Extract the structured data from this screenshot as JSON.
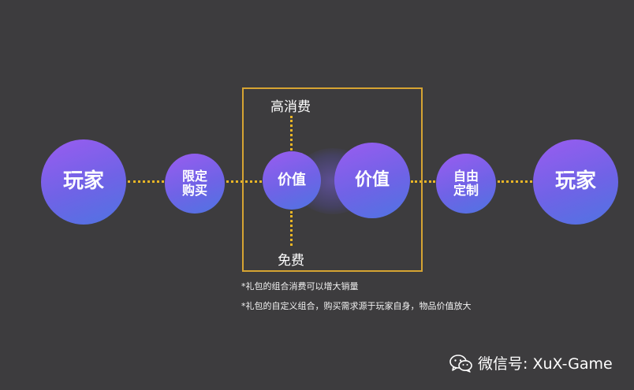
{
  "nodes": {
    "player_left": "玩家",
    "limited_line1": "限定",
    "limited_line2": "购买",
    "value_small": "价值",
    "value_large": "价值",
    "custom_line1": "自由",
    "custom_line2": "定制",
    "player_right": "玩家"
  },
  "axis": {
    "top_label": "高消费",
    "bottom_label": "免费"
  },
  "notes": [
    "*礼包的组合消费可以增大销量",
    "*礼包的自定义组合，购买需求源于玩家自身，物品价值放大"
  ],
  "watermark": {
    "icon": "wechat-icon",
    "text": "微信号: XuX-Game"
  },
  "colors": {
    "background": "#3d3c3e",
    "node_gradient_start": "#9a5cf0",
    "node_gradient_end": "#4f74e2",
    "connector": "#e9b526",
    "frame": "#d6a432"
  }
}
